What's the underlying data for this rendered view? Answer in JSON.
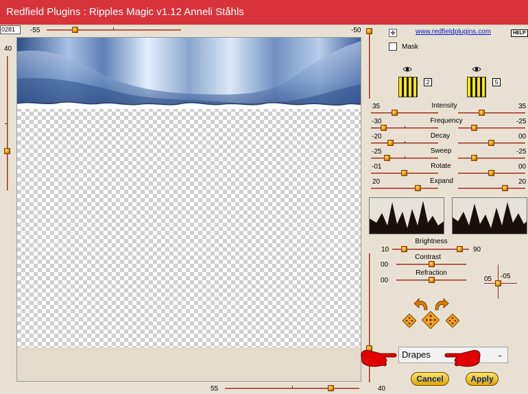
{
  "window": {
    "title": "Redfield Plugins : Ripples Magic v1.12   Anneli Ståhls"
  },
  "top": {
    "seed_value": "0281",
    "h_slider_left": "-55",
    "h_slider_right": "-50"
  },
  "left": {
    "v_slider_value": "40"
  },
  "bottom": {
    "h_slider_value": "55",
    "v_slider_value": "40"
  },
  "header_right": {
    "website_link": "www.redfieldplugins.com",
    "help_label": "HELP",
    "mask_label": "Mask"
  },
  "swatches": {
    "left_index": "2",
    "right_index": "5"
  },
  "sliders": [
    {
      "label": "Intensity",
      "left": "35",
      "right": "35"
    },
    {
      "label": "Frequency",
      "left": "-30",
      "right": "-25"
    },
    {
      "label": "Decay",
      "left": "-20",
      "right": "00"
    },
    {
      "label": "Sweep",
      "left": "-25",
      "right": "-25"
    },
    {
      "label": "Rotate",
      "left": "-01",
      "right": "00"
    },
    {
      "label": "Expand",
      "left": "20",
      "right": "20"
    }
  ],
  "adjust": {
    "brightness": {
      "label": "Brightness",
      "left": "10",
      "right": "90"
    },
    "contrast": {
      "label": "Contrast",
      "value": "00"
    },
    "refraction": {
      "label": "Refraction",
      "value": "00"
    },
    "offset_x": "05",
    "offset_y": "-05"
  },
  "preset": {
    "selected": "Drapes"
  },
  "buttons": {
    "cancel": "Cancel",
    "apply": "Apply"
  },
  "colors": {
    "titlebar": "#d8333a",
    "slider_track": "#8e2b20",
    "knob": "#e08c00",
    "background": "#e8e1d3"
  }
}
